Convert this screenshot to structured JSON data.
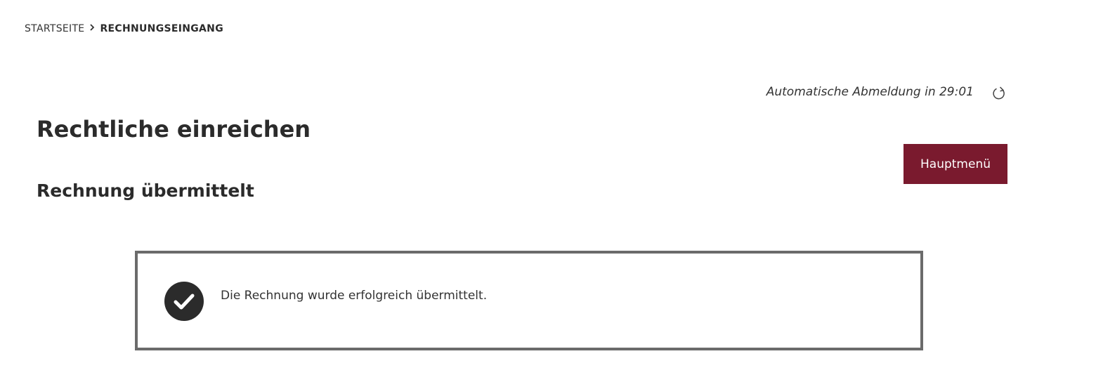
{
  "breadcrumb": {
    "home": "STARTSEITE",
    "separator_icon": "chevron-right-icon",
    "current": "RECHNUNGSEINGANG"
  },
  "session": {
    "logout_timer": "Automatische Abmeldung in 29:01",
    "refresh_icon": "refresh-icon"
  },
  "header": {
    "title": "Rechtliche einreichen",
    "subtitle": "Rechnung übermittelt"
  },
  "actions": {
    "main_menu_label": "Hauptmenü"
  },
  "notification": {
    "icon": "check-circle-icon",
    "message": "Die Rechnung wurde erfolgreich übermittelt."
  },
  "colors": {
    "button_bg": "#7a1a2e",
    "text": "#2b2b2b",
    "box_border": "#6b6b6b",
    "check_circle": "#2b2b2b"
  }
}
